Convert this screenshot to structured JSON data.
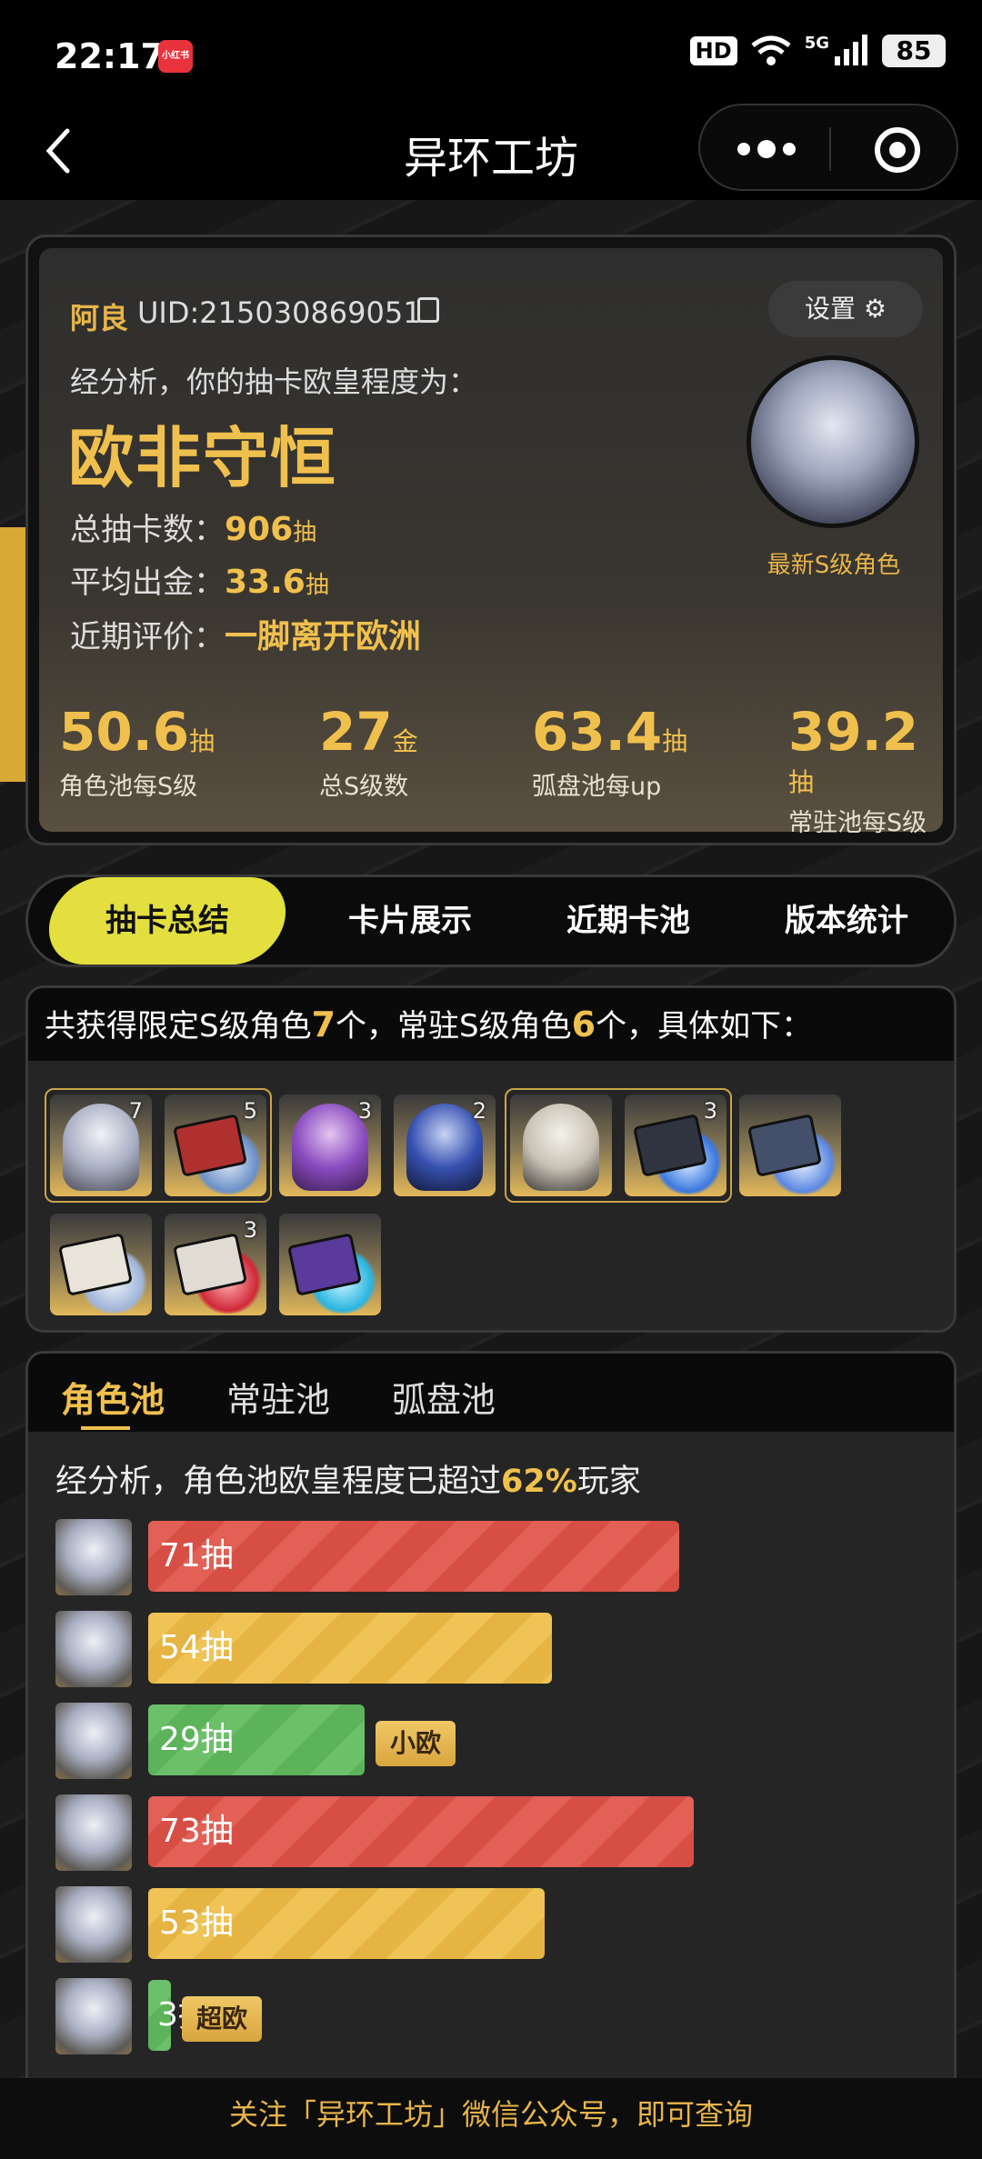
{
  "status_bar": {
    "time": "22:17",
    "app_badge": "小红书",
    "hd": "HD",
    "network": "5G",
    "battery": "85"
  },
  "nav": {
    "title": "异环工坊"
  },
  "profile": {
    "name": "阿良",
    "uid": "UID:215030869051",
    "settings_label": "设置",
    "analysis_text": "经分析，你的抽卡欧皇程度为：",
    "verdict": "欧非守恒",
    "total_label": "总抽卡数：",
    "total_value": "906",
    "avg_label": "平均出金：",
    "avg_value": "33.6",
    "recent_label": "近期评价：",
    "recent_value": "一脚离开欧洲",
    "unit_draw": "抽",
    "avatar_label": "最新S级角色",
    "metrics": [
      {
        "value": "50.6",
        "unit": "抽",
        "label": "角色池每S级"
      },
      {
        "value": "27",
        "unit": "金",
        "label": "总S级数"
      },
      {
        "value": "63.4",
        "unit": "抽",
        "label": "弧盘池每up"
      },
      {
        "value": "39.2",
        "unit": "抽",
        "label": "常驻池每S级"
      }
    ]
  },
  "tabs": [
    "抽卡总结",
    "卡片展示",
    "近期卡池",
    "版本统计"
  ],
  "obtained": {
    "prefix": "共获得限定S级角色",
    "limited": "7",
    "mid": "个，常驻S级角色",
    "standard": "6",
    "suffix": "个，具体如下：",
    "counts": [
      "7",
      "5",
      "3",
      "2",
      "3",
      "3"
    ]
  },
  "pool": {
    "tabs": [
      "角色池",
      "常驻池",
      "弧盘池"
    ],
    "analysis_prefix": "经分析，角色池欧皇程度已超过",
    "analysis_pct": "62%",
    "analysis_suffix": "玩家",
    "bars": [
      {
        "label": "71抽",
        "value": 71,
        "color": "red"
      },
      {
        "label": "54抽",
        "value": 54,
        "color": "yellow"
      },
      {
        "label": "29抽",
        "value": 29,
        "color": "green",
        "badge": "小欧"
      },
      {
        "label": "73抽",
        "value": 73,
        "color": "red"
      },
      {
        "label": "53抽",
        "value": 53,
        "color": "yellow"
      },
      {
        "label": "3抽",
        "value": 3,
        "color": "green",
        "badge": "超欧"
      }
    ]
  },
  "footer": {
    "text": "关注「异环工坊」微信公众号，即可查询"
  }
}
